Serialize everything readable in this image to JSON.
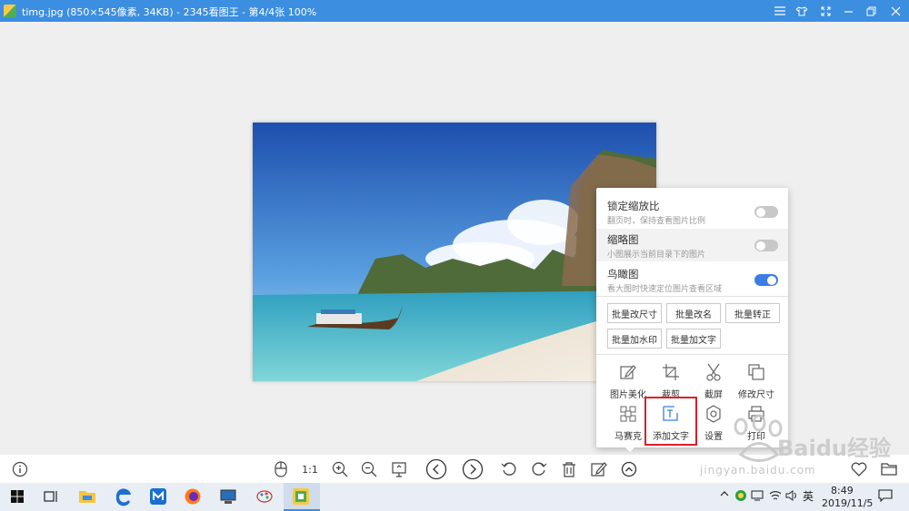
{
  "window": {
    "title": "timg.jpg  (850×545像素, 34KB) - 2345看图王 - 第4/4张 100%",
    "accent": "#3b8ee0",
    "controls": [
      "menu-icon",
      "skin-icon",
      "fullscreen-icon",
      "minimize-icon",
      "restore-icon",
      "close-icon"
    ]
  },
  "panel": {
    "toggles": [
      {
        "title": "锁定缩放比",
        "desc": "翻页时，保持查看图片比例",
        "on": false
      },
      {
        "title": "缩略图",
        "desc": "小图展示当前目录下的图片",
        "on": false
      },
      {
        "title": "鸟瞰图",
        "desc": "看大图时快速定位图片查看区域",
        "on": true
      }
    ],
    "batch_buttons": [
      "批量改尺寸",
      "批量改名",
      "批量转正",
      "批量加水印",
      "批量加文字"
    ],
    "tools": [
      {
        "label": "图片美化",
        "icon": "edit-icon"
      },
      {
        "label": "裁剪",
        "icon": "crop-icon"
      },
      {
        "label": "截屏",
        "icon": "scissors-icon"
      },
      {
        "label": "修改尺寸",
        "icon": "resize-icon"
      },
      {
        "label": "马赛克",
        "icon": "mosaic-icon"
      },
      {
        "label": "添加文字",
        "icon": "add-text-icon"
      },
      {
        "label": "设置",
        "icon": "settings-icon"
      },
      {
        "label": "打印",
        "icon": "print-icon"
      }
    ]
  },
  "toolbar": {
    "actual_size_label": "1:1",
    "icons": [
      "info-icon",
      "mouse-icon",
      "actual-size-icon",
      "zoom-in-icon",
      "zoom-out-icon",
      "fit-icon",
      "previous-icon",
      "next-icon",
      "rotate-left-icon",
      "rotate-right-icon",
      "delete-icon",
      "edit-icon",
      "more-icon",
      "favorite-icon",
      "folder-icon"
    ]
  },
  "taskbar": {
    "ime": "英",
    "time": "8:49",
    "date": "2019/11/5"
  },
  "watermark": {
    "brand": "Baidu经验",
    "url": "jingyan.baidu.com"
  }
}
